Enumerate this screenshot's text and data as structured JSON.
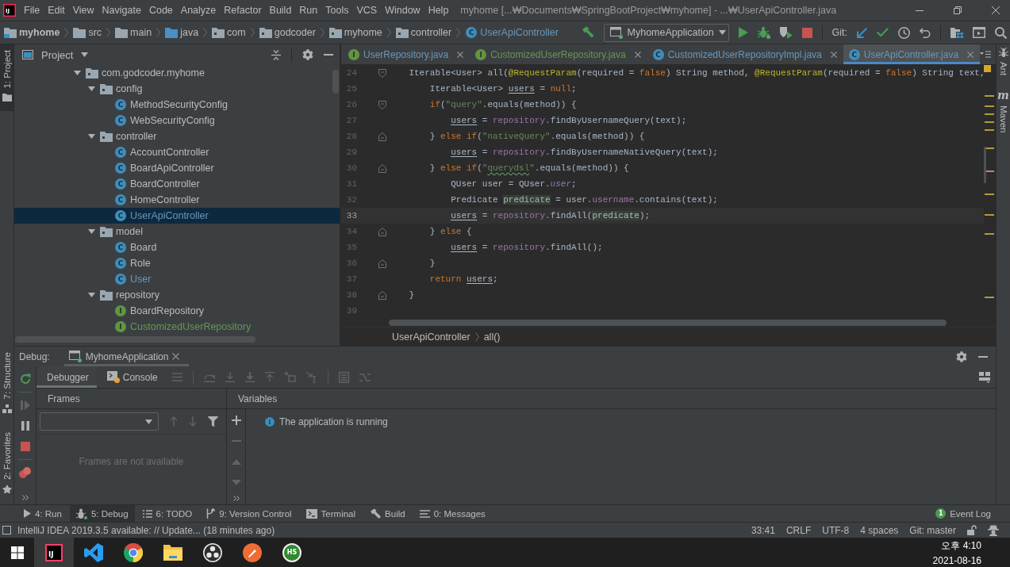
{
  "window": {
    "logo": "IJ",
    "menu": [
      "File",
      "Edit",
      "View",
      "Navigate",
      "Code",
      "Analyze",
      "Refactor",
      "Build",
      "Run",
      "Tools",
      "VCS",
      "Window",
      "Help"
    ],
    "title": "myhome [...₩Documents₩SpringBootProject₩myhome] - ...₩UserApiController.java"
  },
  "navigation_bar": {
    "breadcrumbs": [
      {
        "label": "myhome",
        "kind": "module",
        "color": "#bbbbbb"
      },
      {
        "label": "src",
        "kind": "folder",
        "color": "#bbbbbb"
      },
      {
        "label": "main",
        "kind": "folder",
        "color": "#bbbbbb"
      },
      {
        "label": "java",
        "kind": "source-root",
        "color": "#bbbbbb"
      },
      {
        "label": "com",
        "kind": "package",
        "color": "#bbbbbb"
      },
      {
        "label": "godcoder",
        "kind": "package",
        "color": "#bbbbbb"
      },
      {
        "label": "myhome",
        "kind": "package",
        "color": "#bbbbbb"
      },
      {
        "label": "controller",
        "kind": "package",
        "color": "#bbbbbb"
      },
      {
        "label": "UserApiController",
        "kind": "class",
        "badge": "C",
        "color": "#6897bb"
      }
    ],
    "run_configuration": "MyhomeApplication",
    "vcs_label": "Git:"
  },
  "left_strip": {
    "top": [
      {
        "label": "1: Project",
        "kind": "project",
        "selected": true
      }
    ],
    "bottom": [
      {
        "label": "7: Structure",
        "kind": "structure",
        "selected": false
      },
      {
        "label": "2: Favorites",
        "kind": "favorites",
        "selected": false
      }
    ]
  },
  "project_panel": {
    "title": "Project",
    "tree": [
      {
        "label": "com.godcoder.myhome",
        "kind": "package",
        "expanded": true,
        "selected": false,
        "color": "#bbbbbb",
        "children": [
          {
            "label": "config",
            "kind": "package",
            "expanded": true,
            "selected": false,
            "color": "#bbbbbb",
            "children": [
              {
                "label": "MethodSecurityConfig",
                "kind": "class",
                "badge": "C",
                "color": "#bbbbbb",
                "selected": false
              },
              {
                "label": "WebSecurityConfig",
                "kind": "class",
                "badge": "C",
                "color": "#bbbbbb",
                "selected": false
              }
            ]
          },
          {
            "label": "controller",
            "kind": "package",
            "expanded": true,
            "selected": false,
            "color": "#bbbbbb",
            "children": [
              {
                "label": "AccountController",
                "kind": "class",
                "badge": "C",
                "color": "#bbbbbb",
                "selected": false
              },
              {
                "label": "BoardApiController",
                "kind": "class",
                "badge": "C",
                "color": "#bbbbbb",
                "selected": false
              },
              {
                "label": "BoardController",
                "kind": "class",
                "badge": "C",
                "color": "#bbbbbb",
                "selected": false
              },
              {
                "label": "HomeController",
                "kind": "class",
                "badge": "C",
                "color": "#bbbbbb",
                "selected": false
              },
              {
                "label": "UserApiController",
                "kind": "class",
                "badge": "C",
                "color": "#6897bb",
                "selected": true
              }
            ]
          },
          {
            "label": "model",
            "kind": "package",
            "expanded": true,
            "selected": false,
            "color": "#bbbbbb",
            "children": [
              {
                "label": "Board",
                "kind": "class",
                "badge": "C",
                "color": "#bbbbbb",
                "selected": false
              },
              {
                "label": "Role",
                "kind": "class",
                "badge": "C",
                "color": "#bbbbbb",
                "selected": false
              },
              {
                "label": "User",
                "kind": "class",
                "badge": "C",
                "color": "#6897bb",
                "selected": false
              }
            ]
          },
          {
            "label": "repository",
            "kind": "package",
            "expanded": true,
            "selected": false,
            "color": "#bbbbbb",
            "children": [
              {
                "label": "BoardRepository",
                "kind": "interface",
                "badge": "I",
                "color": "#bbbbbb",
                "selected": false
              },
              {
                "label": "CustomizedUserRepository",
                "kind": "interface",
                "badge": "I",
                "color": "#629755",
                "selected": false
              }
            ]
          }
        ]
      }
    ]
  },
  "editor": {
    "tabs": [
      {
        "label": "UserRepository.java",
        "kind": "interface",
        "badge": "I",
        "color": "#6897bb",
        "selected": false
      },
      {
        "label": "CustomizedUserRepository.java",
        "kind": "interface",
        "badge": "I",
        "color": "#629755",
        "selected": false
      },
      {
        "label": "CustomizedUserRepositoryImpl.java",
        "kind": "class",
        "badge": "C",
        "color": "#6897bb",
        "selected": false
      },
      {
        "label": "UserApiController.java",
        "kind": "class",
        "badge": "C",
        "color": "#6897bb",
        "selected": true
      }
    ],
    "lines": [
      {
        "number": "24",
        "kind": "fold-start",
        "current": false,
        "tokens": [
          {
            "kind": "plain",
            "text": "Iterable<User> all("
          },
          {
            "kind": "annotation",
            "text": "@RequestParam"
          },
          {
            "kind": "plain",
            "text": "(required = "
          },
          {
            "kind": "keyword",
            "text": "false"
          },
          {
            "kind": "plain",
            "text": ") String method, "
          },
          {
            "kind": "annotation",
            "text": "@RequestParam"
          },
          {
            "kind": "plain",
            "text": "(required = "
          },
          {
            "kind": "keyword",
            "text": "false"
          },
          {
            "kind": "plain",
            "text": ") String text,"
          }
        ],
        "children": [
          {
            "number": "25",
            "current": false,
            "tokens": [
              {
                "kind": "plain",
                "text": "Iterable<User> "
              },
              {
                "kind": "reassigned",
                "text": "users"
              },
              {
                "kind": "plain",
                "text": " = "
              },
              {
                "kind": "keyword",
                "text": "null"
              },
              {
                "kind": "plain",
                "text": ";"
              }
            ]
          },
          {
            "number": "26",
            "kind": "fold-start",
            "current": false,
            "tokens": [
              {
                "kind": "keyword",
                "text": "if"
              },
              {
                "kind": "plain",
                "text": "("
              },
              {
                "kind": "string",
                "text": "\"query\""
              },
              {
                "kind": "plain",
                "text": ".equals(method)) {"
              }
            ],
            "children": [
              {
                "number": "27",
                "current": false,
                "tokens": [
                  {
                    "kind": "reassigned",
                    "text": "users"
                  },
                  {
                    "kind": "plain",
                    "text": " = "
                  },
                  {
                    "kind": "field",
                    "text": "repository"
                  },
                  {
                    "kind": "plain",
                    "text": ".findByUsernameQuery(text);"
                  }
                ]
              }
            ]
          },
          {
            "number": "28",
            "kind": "fold-end",
            "current": false,
            "tokens": [
              {
                "kind": "plain",
                "text": "} "
              },
              {
                "kind": "keyword",
                "text": "else if"
              },
              {
                "kind": "plain",
                "text": "("
              },
              {
                "kind": "string",
                "text": "\"nativeQuery\""
              },
              {
                "kind": "plain",
                "text": ".equals(method)) {"
              }
            ],
            "children": [
              {
                "number": "29",
                "current": false,
                "tokens": [
                  {
                    "kind": "reassigned",
                    "text": "users"
                  },
                  {
                    "kind": "plain",
                    "text": " = "
                  },
                  {
                    "kind": "field",
                    "text": "repository"
                  },
                  {
                    "kind": "plain",
                    "text": ".findByUsernameNativeQuery(text);"
                  }
                ]
              }
            ]
          },
          {
            "number": "30",
            "kind": "fold-end",
            "current": false,
            "tokens": [
              {
                "kind": "plain",
                "text": "} "
              },
              {
                "kind": "keyword",
                "text": "else if"
              },
              {
                "kind": "plain",
                "text": "("
              },
              {
                "kind": "string",
                "text": "\""
              },
              {
                "kind": "typo",
                "text": "querydsl"
              },
              {
                "kind": "string",
                "text": "\""
              },
              {
                "kind": "plain",
                "text": ".equals(method)) {"
              }
            ],
            "children": [
              {
                "number": "31",
                "current": false,
                "tokens": [
                  {
                    "kind": "plain",
                    "text": "QUser user = QUser."
                  },
                  {
                    "kind": "static",
                    "text": "user"
                  },
                  {
                    "kind": "plain",
                    "text": ";"
                  }
                ]
              },
              {
                "number": "32",
                "current": false,
                "tokens": [
                  {
                    "kind": "plain",
                    "text": "Predicate "
                  },
                  {
                    "kind": "usage",
                    "text": "predicate"
                  },
                  {
                    "kind": "plain",
                    "text": " = user."
                  },
                  {
                    "kind": "field",
                    "text": "username"
                  },
                  {
                    "kind": "plain",
                    "text": ".contains(text);"
                  }
                ]
              },
              {
                "number": "33",
                "current": true,
                "tokens": [
                  {
                    "kind": "reassigned",
                    "text": "users"
                  },
                  {
                    "kind": "plain",
                    "text": " = "
                  },
                  {
                    "kind": "field",
                    "text": "repository"
                  },
                  {
                    "kind": "plain",
                    "text": ".findAll("
                  },
                  {
                    "kind": "usage",
                    "text": "predicate"
                  },
                  {
                    "kind": "plain",
                    "text": ");"
                  }
                ]
              }
            ]
          },
          {
            "number": "34",
            "kind": "fold-end",
            "current": false,
            "tokens": [
              {
                "kind": "plain",
                "text": "} "
              },
              {
                "kind": "keyword",
                "text": "else"
              },
              {
                "kind": "plain",
                "text": " {"
              }
            ],
            "children": [
              {
                "number": "35",
                "current": false,
                "tokens": [
                  {
                    "kind": "reassigned",
                    "text": "users"
                  },
                  {
                    "kind": "plain",
                    "text": " = "
                  },
                  {
                    "kind": "field",
                    "text": "repository"
                  },
                  {
                    "kind": "plain",
                    "text": ".findAll();"
                  }
                ]
              }
            ]
          },
          {
            "number": "36",
            "kind": "fold-end",
            "current": false,
            "tokens": [
              {
                "kind": "plain",
                "text": "}"
              }
            ]
          },
          {
            "number": "37",
            "current": false,
            "tokens": [
              {
                "kind": "keyword",
                "text": "return "
              },
              {
                "kind": "reassigned",
                "text": "users"
              },
              {
                "kind": "plain",
                "text": ";"
              }
            ]
          }
        ]
      },
      {
        "number": "38",
        "kind": "fold-end",
        "current": false,
        "tokens": [
          {
            "kind": "plain",
            "text": "}"
          }
        ]
      },
      {
        "number": "39",
        "current": false
      }
    ],
    "breadcrumbs": [
      "UserApiController",
      "all()"
    ]
  },
  "right_strip": [
    {
      "label": "Ant",
      "kind": "ant"
    },
    {
      "label": "Maven",
      "kind": "maven",
      "badge": "m"
    }
  ],
  "debug_panel": {
    "title": "Debug:",
    "session": "MyhomeApplication",
    "tabs": [
      {
        "label": "Debugger",
        "kind": "debugger",
        "selected": true
      },
      {
        "label": "Console",
        "kind": "console",
        "selected": false
      }
    ],
    "frames": {
      "title": "Frames",
      "empty_text": "Frames are not available"
    },
    "variables": {
      "title": "Variables",
      "message": "The application is running"
    }
  },
  "tool_windows": {
    "tabs": [
      {
        "label": "4: Run",
        "kind": "run",
        "selected": false
      },
      {
        "label": "5: Debug",
        "kind": "debug",
        "selected": true
      },
      {
        "label": "6: TODO",
        "kind": "todo",
        "selected": false
      },
      {
        "label": "9: Version Control",
        "kind": "vcs",
        "selected": false
      },
      {
        "label": "Terminal",
        "kind": "terminal",
        "selected": false
      },
      {
        "label": "Build",
        "kind": "build",
        "selected": false
      },
      {
        "label": "0: Messages",
        "kind": "messages",
        "selected": false
      }
    ],
    "event_log": {
      "label": "Event Log",
      "count": "1"
    }
  },
  "status_bar": {
    "message": "IntelliJ IDEA 2019.3.5 available: // Update... (18 minutes ago)",
    "items": [
      "33:41",
      "CRLF",
      "UTF-8",
      "4 spaces",
      "Git: master"
    ]
  },
  "taskbar": {
    "apps": [
      {
        "kind": "intellij",
        "label": "IJ",
        "selected": true
      },
      {
        "kind": "vscode",
        "selected": false
      },
      {
        "kind": "chrome",
        "selected": false
      },
      {
        "kind": "explorer",
        "selected": false
      },
      {
        "kind": "obs",
        "selected": false
      },
      {
        "kind": "postman",
        "selected": false
      },
      {
        "kind": "hs",
        "label": "HS",
        "selected": false
      }
    ],
    "clock": {
      "time": "오후 4:10",
      "date": "2021-08-16"
    }
  }
}
